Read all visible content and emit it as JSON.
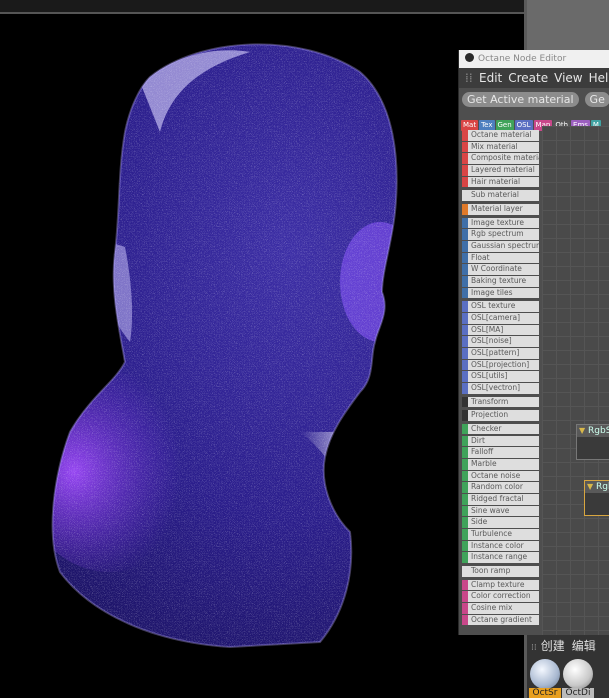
{
  "viewport": {
    "subject": "noisy render of a human head bust"
  },
  "node_editor": {
    "title": "Octane Node Editor",
    "menu": [
      "Edit",
      "Create",
      "View",
      "Help"
    ],
    "buttons": [
      "Get Active material",
      "Ge"
    ],
    "tabs": [
      {
        "label": "Mat",
        "color": "#d94545"
      },
      {
        "label": "Tex",
        "color": "#4d7fbf"
      },
      {
        "label": "Gen",
        "color": "#3fa35a"
      },
      {
        "label": "OSL",
        "color": "#5a6fc2"
      },
      {
        "label": "Map",
        "color": "#c9478a"
      },
      {
        "label": "Oth",
        "color": "#555555"
      },
      {
        "label": "Ems",
        "color": "#9c5fc0"
      },
      {
        "label": "M",
        "color": "#40a3a3"
      }
    ],
    "nodes": [
      {
        "label": "Octane material",
        "color": "#d94545"
      },
      {
        "label": "Mix material",
        "color": "#d94545"
      },
      {
        "label": "Composite material",
        "color": "#d94545"
      },
      {
        "label": "Layered material",
        "color": "#d94545"
      },
      {
        "label": "Hair material",
        "color": "#d94545",
        "sep": true
      },
      {
        "label": "Sub material",
        "color": "#dedede",
        "sep": true
      },
      {
        "label": "Material layer",
        "color": "#e07a2a",
        "sep": true
      },
      {
        "label": "Image texture",
        "color": "#3f6fa8"
      },
      {
        "label": "Rgb spectrum",
        "color": "#3f6fa8"
      },
      {
        "label": "Gaussian spectrum",
        "color": "#3f6fa8"
      },
      {
        "label": "Float",
        "color": "#3f6fa8"
      },
      {
        "label": "W Coordinate",
        "color": "#3f6fa8"
      },
      {
        "label": "Baking texture",
        "color": "#3f6fa8"
      },
      {
        "label": "Image tiles",
        "color": "#3f6fa8",
        "sep": true
      },
      {
        "label": "OSL texture",
        "color": "#5a6fc2"
      },
      {
        "label": "OSL[camera]",
        "color": "#5a6fc2"
      },
      {
        "label": "OSL[MA]",
        "color": "#5a6fc2"
      },
      {
        "label": "OSL[noise]",
        "color": "#5a6fc2"
      },
      {
        "label": "OSL[pattern]",
        "color": "#5a6fc2"
      },
      {
        "label": "OSL[projection]",
        "color": "#5a6fc2"
      },
      {
        "label": "OSL[utils]",
        "color": "#5a6fc2"
      },
      {
        "label": "OSL[vectron]",
        "color": "#5a6fc2",
        "sep": true
      },
      {
        "label": "Transform",
        "color": "#333333",
        "sep": true
      },
      {
        "label": "Projection",
        "color": "#333333",
        "sep": true
      },
      {
        "label": "Checker",
        "color": "#3fa35a"
      },
      {
        "label": "Dirt",
        "color": "#3fa35a"
      },
      {
        "label": "Falloff",
        "color": "#3fa35a"
      },
      {
        "label": "Marble",
        "color": "#3fa35a"
      },
      {
        "label": "Octane noise",
        "color": "#3fa35a"
      },
      {
        "label": "Random color",
        "color": "#3fa35a"
      },
      {
        "label": "Ridged fractal",
        "color": "#3fa35a"
      },
      {
        "label": "Sine wave",
        "color": "#3fa35a"
      },
      {
        "label": "Side",
        "color": "#3fa35a"
      },
      {
        "label": "Turbulence",
        "color": "#3fa35a"
      },
      {
        "label": "Instance color",
        "color": "#3fa35a"
      },
      {
        "label": "Instance range",
        "color": "#3fa35a",
        "sep": true
      },
      {
        "label": "Toon ramp",
        "color": "#dedede",
        "sep": true
      },
      {
        "label": "Clamp texture",
        "color": "#c9478a"
      },
      {
        "label": "Color correction",
        "color": "#c9478a"
      },
      {
        "label": "Cosine mix",
        "color": "#c9478a"
      },
      {
        "label": "Octane gradient",
        "color": "#c9478a"
      }
    ],
    "canvas_nodes": [
      "RgbS",
      "Rgb"
    ]
  },
  "material_manager": {
    "menu": [
      "创建",
      "编辑"
    ],
    "materials": [
      "OctSr",
      "OctDi"
    ]
  }
}
